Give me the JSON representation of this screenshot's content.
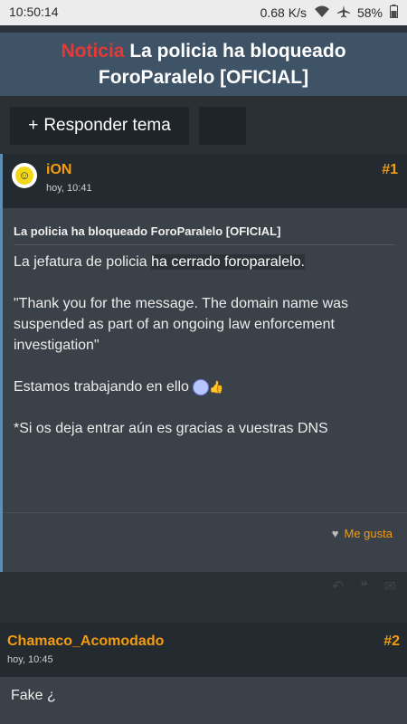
{
  "status": {
    "time": "10:50:14",
    "speed": "0.68 K/s",
    "battery": "58%",
    "icons": [
      "wifi-icon",
      "airplane-icon",
      "battery-icon"
    ]
  },
  "thread": {
    "notice": "Noticia",
    "title_line1": "La policia ha bloqueado",
    "title_line2": "ForoParalelo [OFICIAL]"
  },
  "actions": {
    "reply_label": "Responder tema",
    "reply_icon": "+"
  },
  "posts": [
    {
      "username": "iON",
      "date": "hoy, 10:41",
      "number": "#1",
      "title": "La policia ha bloqueado ForoParalelo [OFICIAL]",
      "line1_a": "La jefatura de policia ",
      "line1_b": "ha cerrado foroparalelo.",
      "quote": "\"Thank you for the message. The domain name was suspended as part of an ongoing law enforcement investigation\"",
      "line3": "Estamos trabajando en ello",
      "line4": "*Si os deja entrar aún es gracias a vuestras DNS",
      "like_label": "Me gusta"
    },
    {
      "username": "Chamaco_Acomodado",
      "date": "hoy, 10:45",
      "number": "#2",
      "body": "Fake ¿"
    }
  ],
  "colors": {
    "accent": "#f39c12",
    "notice": "#e53935",
    "header_bar": "#3f5366",
    "post_bg": "#3b4148"
  }
}
